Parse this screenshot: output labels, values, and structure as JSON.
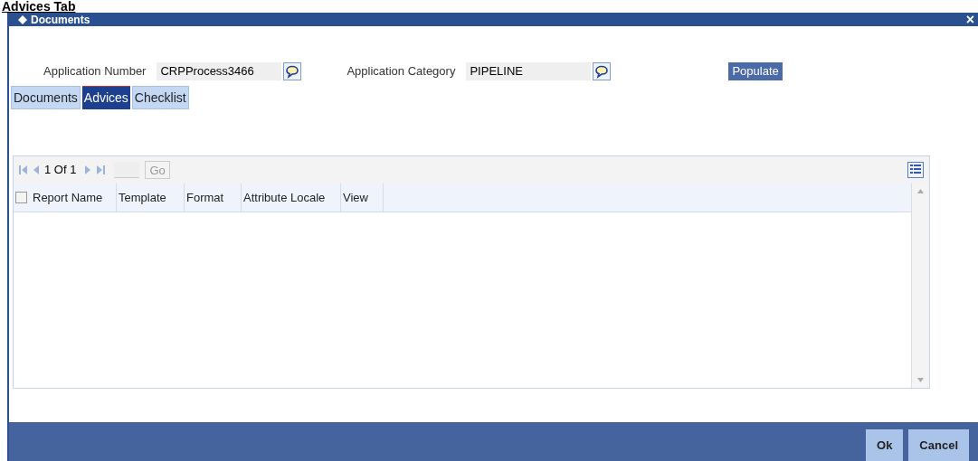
{
  "heading": "Advices Tab",
  "window": {
    "title": "Documents",
    "close": "×"
  },
  "fields": [
    {
      "label": "Application Number",
      "value": "CRPProcess3466"
    },
    {
      "label": "Application Category",
      "value": "PIPELINE"
    }
  ],
  "populate_button": "Populate",
  "tabs": [
    {
      "label": "Documents",
      "selected": false
    },
    {
      "label": "Advices",
      "selected": true
    },
    {
      "label": "Checklist",
      "selected": false
    }
  ],
  "pager": {
    "text": "1 Of 1",
    "go": "Go"
  },
  "table": {
    "select_all": {
      "checked": false
    },
    "columns": [
      "Report Name",
      "Template",
      "Format",
      "Attribute Locale",
      "View"
    ]
  },
  "buttons": [
    "Ok",
    "Cancel"
  ]
}
